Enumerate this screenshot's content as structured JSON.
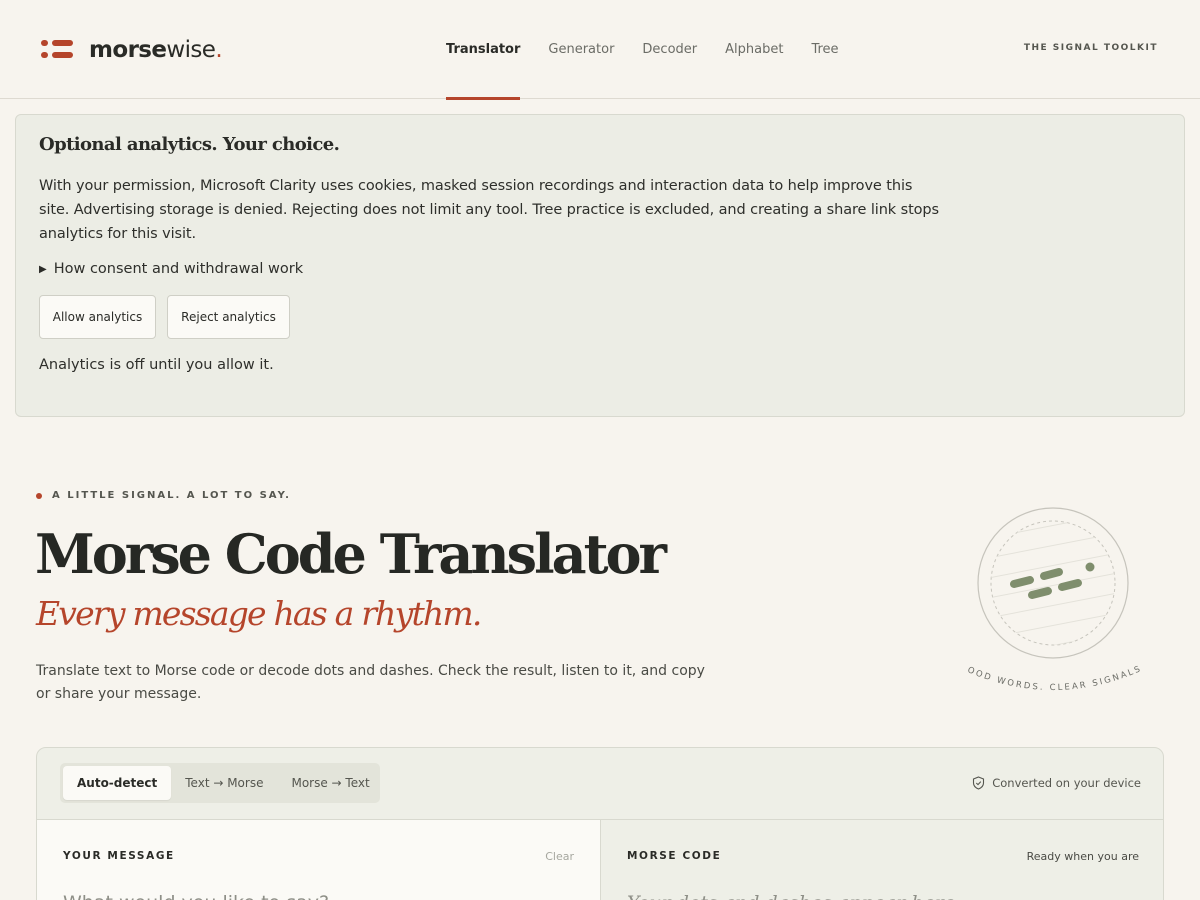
{
  "brand": {
    "name_part1": "morse",
    "name_part2": "wise",
    "name_dot": ".",
    "accent_color": "#b5452b"
  },
  "nav": {
    "items": [
      {
        "label": "Translator",
        "active": true
      },
      {
        "label": "Generator"
      },
      {
        "label": "Decoder"
      },
      {
        "label": "Alphabet"
      },
      {
        "label": "Tree"
      }
    ],
    "tagline": "THE SIGNAL TOOLKIT"
  },
  "consent": {
    "title": "Optional analytics. Your choice.",
    "body": "With your permission, Microsoft Clarity uses cookies, masked session recordings and interaction data to help improve this site. Advertising storage is denied. Rejecting does not limit any tool. Tree practice is excluded, and creating a share link stops analytics for this visit.",
    "details_label": "How consent and withdrawal work",
    "allow_label": "Allow analytics",
    "reject_label": "Reject analytics",
    "status": "Analytics is off until you allow it."
  },
  "hero": {
    "eyebrow": "A LITTLE SIGNAL. A LOT TO SAY.",
    "title": "Morse Code Translator",
    "tagline": "Every message has a rhythm.",
    "description": "Translate text to Morse code or decode dots and dashes. Check the result, listen to it, and copy or share your message.",
    "stamp_text": "GOOD WORDS. CLEAR SIGNALS."
  },
  "translator": {
    "modes": [
      {
        "label": "Auto-detect",
        "active": true
      },
      {
        "label": "Text → Morse"
      },
      {
        "label": "Morse → Text"
      }
    ],
    "device_note": "Converted on your device",
    "input": {
      "label": "YOUR MESSAGE",
      "clear_label": "Clear",
      "placeholder": "What would you like to say?"
    },
    "output": {
      "label": "MORSE CODE",
      "status": "Ready when you are",
      "placeholder": "Your dots and dashes appear here"
    }
  }
}
